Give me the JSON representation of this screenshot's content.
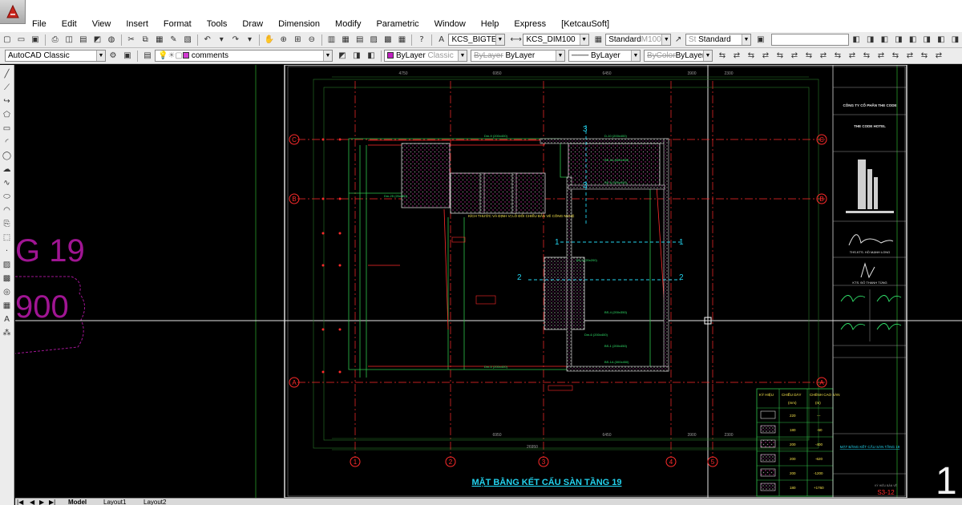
{
  "menubar": {
    "items": [
      "File",
      "Edit",
      "View",
      "Insert",
      "Format",
      "Tools",
      "Draw",
      "Dimension",
      "Modify",
      "Parametric",
      "Window",
      "Help",
      "Express",
      "[KetcauSoft]"
    ]
  },
  "toolbar1": {
    "text_style": "KCS_BIGTEX",
    "dim_style": "KCS_DIM100",
    "table_style": "Standard",
    "table_style_ghost": "M100",
    "multileader_style_ghost": "St",
    "multileader_style": "Standard"
  },
  "toolbar2": {
    "workspace": "AutoCAD Classic",
    "layer": "comments",
    "color": "ByLayer",
    "color_ghost": "Classic",
    "linetype": "ByLayer",
    "linetype_ghost": "ByLayer",
    "lineweight": "ByLayer",
    "plotstyle": "ByLayer",
    "plotstyle_ghost": "ByColor"
  },
  "tabs": [
    "Model",
    "Layout1",
    "Layout2"
  ],
  "colors": {
    "background": "#000000",
    "grid_red": "#ff2b2b",
    "text_green": "#31e36b",
    "text_cyan": "#22d3ee",
    "magenta": "#a01593",
    "frame_white": "#d9d9d9",
    "hatch": "#b82a8f"
  },
  "drawing": {
    "left_text_level": "G 19",
    "left_text_elev": "900",
    "title_text": "MẶT BẰNG KẾT CẤU SÀN TẦNG 19",
    "annotation_note": "KÍCH THƯỚC VÀ ĐỊNH VỊ LỖ ĐỐI CHIẾU BẢN VẼ CÔNG NGHỆ",
    "row_axes": [
      "C",
      "B",
      "A"
    ],
    "col_axes": [
      "1",
      "2",
      "3",
      "4",
      "5"
    ],
    "section_marks": [
      "1",
      "2",
      "3"
    ],
    "big_number": "1",
    "dim_labels_top": [
      "4750",
      "6950",
      "6450",
      "3900",
      "2300"
    ],
    "dim_labels_bottom": [
      "26950",
      "6950",
      "6450",
      "3900",
      "2300"
    ],
    "beam_labels": [
      "Dm-9 (200x400)",
      "Dm-25 (20x300)",
      "D-10 (200x400)",
      "BS-1A (300x450)",
      "BS-8 (300x450)",
      "BS-5 (20x200)",
      "Dm-6 (200x400)",
      "BS-1 (200x450)",
      "BS-4 (200x350)",
      "Dm-5 (200x400)",
      "BS-1A (300x450)"
    ]
  },
  "title_block": {
    "company": "CÔNG TY CỔ PHẦN THE CODE",
    "project": "THE CODE HOTEL",
    "signer1": "THS.KTS. HỒ MẠNH LONG",
    "signer2": "KTS. ĐỖ THANH TÙNG",
    "drawing_name": "MẶT BẰNG KẾT CẤU SÀN TẦNG 19",
    "sheet_no": "S3-12",
    "sheet_label": "KÝ HIỆU BẢN VẼ"
  },
  "legend": {
    "headers": [
      "KÝ HIỆU",
      "CHIỀU DÀY",
      "CHÊNH CAO SÀN"
    ],
    "units": [
      "",
      "(mm)",
      "(m)"
    ],
    "rows": [
      {
        "thickness": "220",
        "elev": "---"
      },
      {
        "thickness": "180",
        "elev": "-60"
      },
      {
        "thickness": "200",
        "elev": "-400"
      },
      {
        "thickness": "200",
        "elev": "-620"
      },
      {
        "thickness": "200",
        "elev": "-1200"
      },
      {
        "thickness": "180",
        "elev": "+1760"
      }
    ]
  }
}
